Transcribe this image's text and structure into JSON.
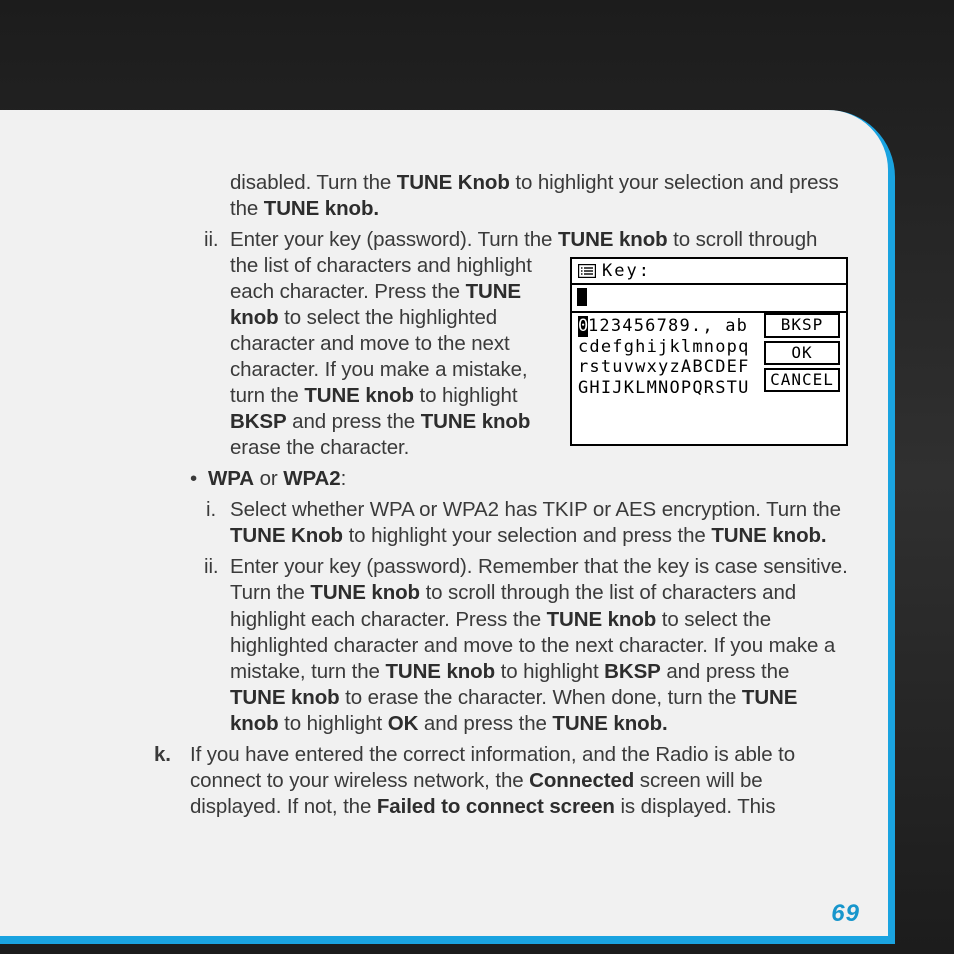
{
  "page_number": "69",
  "para_disabled_a": "disabled. Turn the ",
  "para_disabled_b": "TUNE Knob",
  "para_disabled_c": " to highlight your selection and press the ",
  "para_disabled_d": "TUNE knob.",
  "wep_ii_marker": "ii.",
  "wep_ii_lead_a": "Enter your key (password). Turn the ",
  "wep_ii_lead_b": "TUNE knob",
  "wep_ii_lead_c": " to scroll through",
  "wep_ii_wrap_1a": "the list of characters and highlight each character. Press the ",
  "wep_ii_wrap_1b": "TUNE knob",
  "wep_ii_wrap_1c": " to select the highlighted character and move to the next character. If you make a mistake, turn the ",
  "wep_ii_wrap_1d": "TUNE knob",
  "wep_ii_wrap_1e": " to highlight ",
  "wep_ii_wrap_1f": "BKSP",
  "wep_ii_wrap_1g": " and press the ",
  "wep_ii_wrap_1h": "TUNE knob",
  "wep_ii_wrap_1i": " erase the character.",
  "bullet_dot": "•",
  "bullet_a": "WPA",
  "bullet_or": " or ",
  "bullet_b": "WPA2",
  "bullet_colon": ":",
  "wpa_i_marker": "i.",
  "wpa_i_a": "Select whether WPA or WPA2 has TKIP or AES encryption. Turn the ",
  "wpa_i_b": "TUNE Knob",
  "wpa_i_c": " to highlight your selection and press the ",
  "wpa_i_d": "TUNE knob.",
  "wpa_ii_marker": "ii.",
  "wpa_ii_a": "Enter your key (password). Remember that the key is case sensitive. Turn the ",
  "wpa_ii_b": "TUNE knob",
  "wpa_ii_c": " to scroll through the list of characters and highlight each character. Press the ",
  "wpa_ii_d": "TUNE knob",
  "wpa_ii_e": " to select the highlighted character and move to the next character. If you make a mistake, turn the ",
  "wpa_ii_f": "TUNE knob",
  "wpa_ii_g": " to highlight ",
  "wpa_ii_h": "BKSP",
  "wpa_ii_i": " and press the ",
  "wpa_ii_j": "TUNE knob",
  "wpa_ii_k": " to erase the character. When done, turn the ",
  "wpa_ii_l": "TUNE knob",
  "wpa_ii_m": " to highlight ",
  "wpa_ii_n": "OK",
  "wpa_ii_o": " and press the ",
  "wpa_ii_p": "TUNE knob.",
  "k_marker": "k.",
  "k_a": "If you have entered the correct information, and the Radio is able to connect to your wireless network, the ",
  "k_b": "Connected",
  "k_c": " screen will be displayed. If not, the ",
  "k_d": "Failed to connect screen",
  "k_e": " is displayed. This",
  "figure": {
    "title": "Key:",
    "highlight_char": "0",
    "row1_rest": "123456789., ab",
    "row2": "cdefghijklmnopq",
    "row3": "rstuvwxyzABCDEF",
    "row4": "GHIJKLMNOPQRSTU",
    "btn_bksp": "BKSP",
    "btn_ok": "OK",
    "btn_cancel": "CANCEL"
  }
}
